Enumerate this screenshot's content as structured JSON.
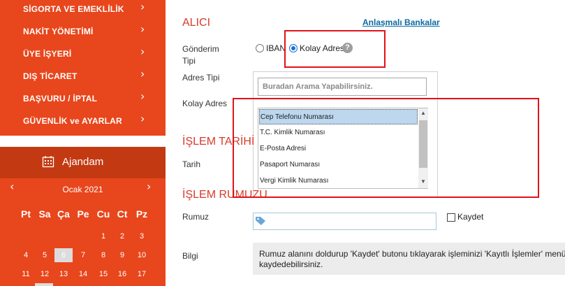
{
  "sidebar": {
    "menu": [
      {
        "label": "SİGORTA VE EMEKLİLİK"
      },
      {
        "label": "NAKİT YÖNETİMİ"
      },
      {
        "label": "ÜYE İŞYERİ"
      },
      {
        "label": "DIŞ TİCARET"
      },
      {
        "label": "BAŞVURU / İPTAL"
      },
      {
        "label": "GÜVENLİK ve AYARLAR"
      }
    ],
    "chevron": "›",
    "agenda_label": "Ajandam",
    "calendar": {
      "month": "Ocak 2021",
      "prev": "‹",
      "next": "›",
      "weekdays": [
        "Pt",
        "Sa",
        "Ça",
        "Pe",
        "Cu",
        "Ct",
        "Pz"
      ],
      "week1": [
        "1",
        "2",
        "3"
      ],
      "week2": [
        "4",
        "5",
        "6",
        "7",
        "8",
        "9",
        "10"
      ],
      "week3": [
        "11",
        "12",
        "13",
        "14",
        "15",
        "16",
        "17"
      ]
    }
  },
  "form": {
    "alici_title": "ALICI",
    "bank_link": "Anlaşmalı Bankalar",
    "gonderim_label_1": "Gönderim",
    "gonderim_label_2": "Tipi",
    "iban_label": "IBAN",
    "kolay_adres_radio": "Kolay Adres",
    "help": "?",
    "adres_tipi_label": "Adres Tipi",
    "kolay_adres_label": "Kolay Adres",
    "search_placeholder": "Buradan Arama Yapabilirsiniz.",
    "options": [
      "Cep Telefonu Numarası",
      "T.C. Kimlik Numarası",
      "E-Posta Adresi",
      "Pasaport Numarası",
      "Vergi Kimlik Numarası"
    ],
    "islem_tarihi_title": "İŞLEM TARİHİ",
    "tarih_label": "Tarih",
    "islem_rumuzu_title": "İŞLEM RUMUZU",
    "rumuz_label": "Rumuz",
    "kaydet_label": "Kaydet",
    "bilgi_label": "Bilgi",
    "info_line1": "Rumuz alanını doldurup 'Kaydet' butonu tıklayarak işleminizi 'Kayıtlı İşlemler' menüsüne",
    "info_line2": "kaydedebilirsiniz."
  },
  "colors": {
    "sidebar": "#e8461c",
    "agenda_header": "#c33a12",
    "section_title": "#d83a2a",
    "link": "#0a6aa1",
    "highlight_box": "#e0121b"
  }
}
